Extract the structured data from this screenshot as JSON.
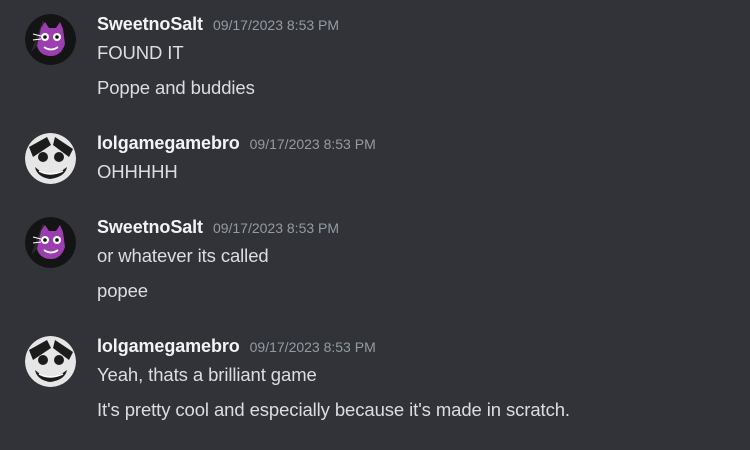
{
  "colors": {
    "background": "#313338",
    "username": "#f2f3f5",
    "timestamp": "#949ba4",
    "message_text": "#dbdee1"
  },
  "messages": [
    {
      "author": "SweetnoSalt",
      "avatar_icon": "purple-cat-avatar",
      "timestamp": "09/17/2023 8:53 PM",
      "lines": [
        "FOUND IT",
        "Poppe and buddies"
      ]
    },
    {
      "author": "lolgamegamebro",
      "avatar_icon": "grayscale-face-avatar",
      "timestamp": "09/17/2023 8:53 PM",
      "lines": [
        "OHHHHH"
      ]
    },
    {
      "author": "SweetnoSalt",
      "avatar_icon": "purple-cat-avatar",
      "timestamp": "09/17/2023 8:53 PM",
      "lines": [
        "or whatever its called",
        "popee"
      ]
    },
    {
      "author": "lolgamegamebro",
      "avatar_icon": "grayscale-face-avatar",
      "timestamp": "09/17/2023 8:53 PM",
      "lines": [
        "Yeah, thats a brilliant game",
        "It's pretty cool and especially because it's made in scratch."
      ]
    }
  ]
}
